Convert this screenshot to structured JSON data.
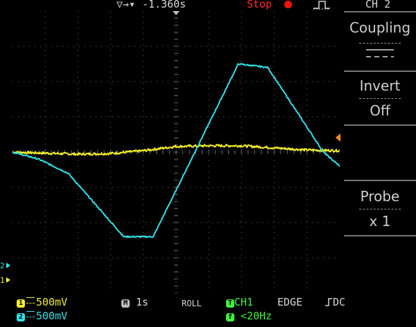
{
  "header": {
    "trigger_position_icon": "trigger-position-arrow",
    "time_offset": "-1.360s",
    "run_status": "Stop",
    "trigger_edge_icon": "rising-edge",
    "channel_title": "CH 2"
  },
  "side_menu": {
    "coupling": {
      "title": "Coupling",
      "value_icon": "dc-coupling"
    },
    "invert": {
      "title": "Invert",
      "value": "Off"
    },
    "probe": {
      "title": "Probe",
      "value": "x 1"
    }
  },
  "markers": {
    "ch1_ground": "1",
    "ch2_ground": "2",
    "ch1_ground_ylevel_v": -1.7,
    "ch2_ground_ylevel_v": -1.5,
    "trigger_level_icon": "trigger-level-arrow"
  },
  "status_bar": {
    "ch1_badge": "1",
    "ch1_scale": "500mV",
    "ch2_badge": "2",
    "ch2_scale": "500mV",
    "timebase_badge": "M",
    "timebase": "1s",
    "mode": "ROLL",
    "trigger_badge": "T",
    "trigger_source": "CH1",
    "trigger_type": "EDGE",
    "trigger_slope_icon": "rising-slope",
    "trigger_coupling": "DC",
    "freq_badge": "f",
    "frequency": "<20Hz"
  },
  "colors": {
    "ch1": "#f2ee2a",
    "ch2": "#33e0e8",
    "trigger": "#40f040",
    "stop": "#ff2a2a",
    "grid": "#6a6a6a",
    "trigger_marker": "#ff8c1a"
  },
  "chart_data": {
    "type": "line",
    "x_unit": "s",
    "y_unit": "V",
    "xlim": [
      -5,
      5
    ],
    "ylim": [
      -2,
      2
    ],
    "divisions": {
      "x": 10,
      "y": 8
    },
    "grid": true,
    "series": [
      {
        "name": "CH1",
        "x": [
          -5,
          -3,
          -2,
          -1,
          0,
          1,
          2,
          3,
          4,
          5
        ],
        "y": [
          0,
          -0.03,
          -0.02,
          0.02,
          0.08,
          0.09,
          0.09,
          0.06,
          0.03,
          0.02
        ]
      },
      {
        "name": "CH2",
        "x": [
          -5,
          -4.2,
          -3.3,
          -1.6,
          -0.7,
          1.9,
          2.8,
          4.5,
          5
        ],
        "y": [
          0,
          -0.1,
          -0.3,
          -1.2,
          -1.2,
          1.25,
          1.2,
          0,
          -0.2
        ]
      }
    ]
  }
}
